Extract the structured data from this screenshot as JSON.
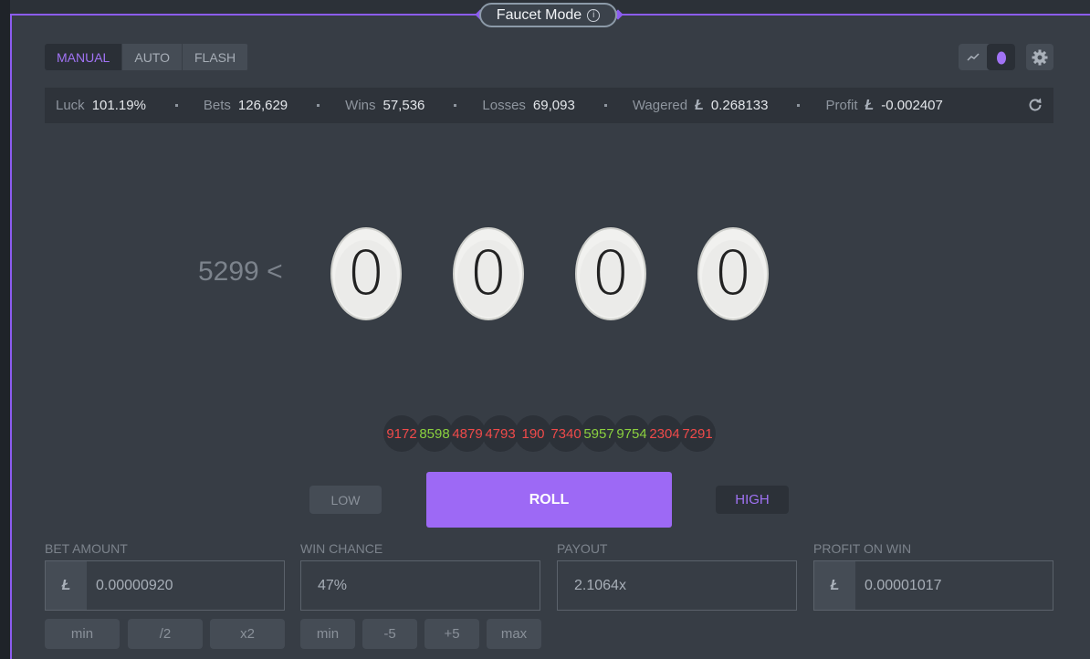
{
  "header": {
    "title": "Faucet Mode"
  },
  "mode_tabs": [
    {
      "label": "MANUAL",
      "active": true
    },
    {
      "label": "AUTO",
      "active": false
    },
    {
      "label": "FLASH",
      "active": false
    }
  ],
  "stats": {
    "luck_label": "Luck",
    "luck_value": "101.19%",
    "bets_label": "Bets",
    "bets_value": "126,629",
    "wins_label": "Wins",
    "wins_value": "57,536",
    "losses_label": "Losses",
    "losses_value": "69,093",
    "wagered_label": "Wagered",
    "wagered_value": "0.268133",
    "profit_label": "Profit",
    "profit_value": "-0.002407",
    "currency_symbol": "Ł"
  },
  "game": {
    "target_text": "5299 <",
    "egg_digits": [
      "0",
      "0",
      "0",
      "0"
    ]
  },
  "history": [
    {
      "value": "9172",
      "result": "loss"
    },
    {
      "value": "8598",
      "result": "win"
    },
    {
      "value": "4879",
      "result": "loss"
    },
    {
      "value": "4793",
      "result": "loss"
    },
    {
      "value": "190",
      "result": "loss"
    },
    {
      "value": "7340",
      "result": "loss"
    },
    {
      "value": "5957",
      "result": "win"
    },
    {
      "value": "9754",
      "result": "win"
    },
    {
      "value": "2304",
      "result": "loss"
    },
    {
      "value": "7291",
      "result": "loss"
    }
  ],
  "controls": {
    "low_label": "LOW",
    "roll_label": "ROLL",
    "high_label": "HIGH",
    "selected_side": "HIGH"
  },
  "fields": {
    "bet_amount_label": "BET AMOUNT",
    "bet_amount_value": "0.00000920",
    "win_chance_label": "WIN CHANCE",
    "win_chance_value": "47%",
    "payout_label": "PAYOUT",
    "payout_value": "2.1064x",
    "profit_label": "PROFIT ON WIN",
    "profit_value": "0.00001017"
  },
  "bet_buttons": {
    "min": "min",
    "half": "/2",
    "double": "x2"
  },
  "chance_buttons": {
    "min": "min",
    "minus5": "-5",
    "plus5": "+5",
    "max": "max"
  },
  "colors": {
    "accent": "#9d69f5",
    "win": "#8bd13f",
    "loss": "#ef4a4a"
  }
}
